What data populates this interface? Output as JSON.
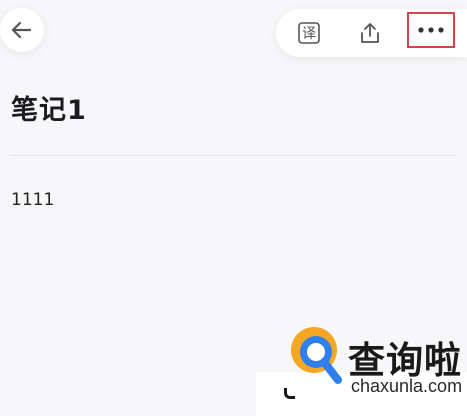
{
  "header": {
    "back_icon": "arrow-left-icon",
    "toolbar": {
      "translate_icon": "translate-icon",
      "translate_glyph": "译",
      "share_icon": "share-icon",
      "more_icon": "more-horizontal-icon"
    }
  },
  "note": {
    "title": "笔记1",
    "body": "1111"
  },
  "watermark": {
    "name": "查询啦",
    "domain": "chaxunla.com"
  },
  "colors": {
    "highlight_border": "#d8434a",
    "logo_orange": "#f5a623",
    "logo_blue": "#2f80ed"
  }
}
